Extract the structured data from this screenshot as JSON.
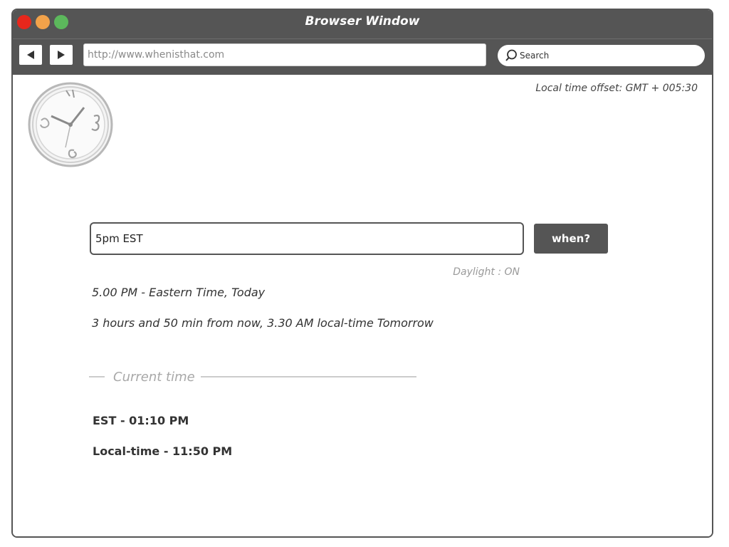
{
  "window": {
    "title": "Browser Window"
  },
  "toolbar": {
    "back_icon": "back-arrow-icon",
    "forward_icon": "forward-arrow-icon",
    "url": "http://www.whenisthat.com",
    "search_placeholder": "Search",
    "search_icon": "search-icon"
  },
  "header": {
    "offset_label": "Local time offset: GMT + 005:30",
    "logo_icon": "clock-icon"
  },
  "query": {
    "value": "5pm EST",
    "button_label": "when?"
  },
  "result": {
    "daylight": "Daylight : ON",
    "line_one": "5.00 PM - Eastern Time, Today",
    "line_two": "3 hours and 50 min from now, 3.30 AM local-time Tomorrow"
  },
  "current_time": {
    "section_label": "Current time",
    "est": "EST - 01:10 PM",
    "local": "Local-time - 11:50 PM"
  },
  "colors": {
    "chrome": "#555555",
    "close": "#e8271c",
    "minimize": "#f2a24a",
    "maximize": "#5cb85c",
    "muted_text": "#9a9a9a"
  }
}
